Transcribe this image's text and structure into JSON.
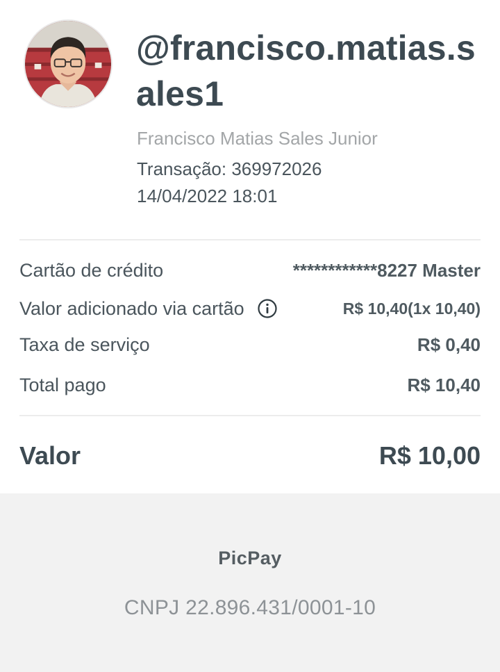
{
  "profile": {
    "username": "@francisco.matias.sales1",
    "full_name": "Francisco Matias Sales Junior",
    "transaction": "Transação: 369972026",
    "datetime": "14/04/2022 18:01"
  },
  "details": [
    {
      "label": "Cartão de crédito",
      "value": "************8227 Master"
    },
    {
      "label": "Valor adicionado via cartão",
      "value": "R$ 10,40(1x 10,40)",
      "icon": "info-icon"
    },
    {
      "label": "Taxa de serviço",
      "value": "R$ 0,40"
    },
    {
      "label": "Total pago",
      "value": "R$ 10,40"
    }
  ],
  "summary": {
    "label": "Valor",
    "value": "R$ 10,00"
  },
  "footer": {
    "brand": "PicPay",
    "cnpj": "CNPJ 22.896.431/0001-10"
  }
}
